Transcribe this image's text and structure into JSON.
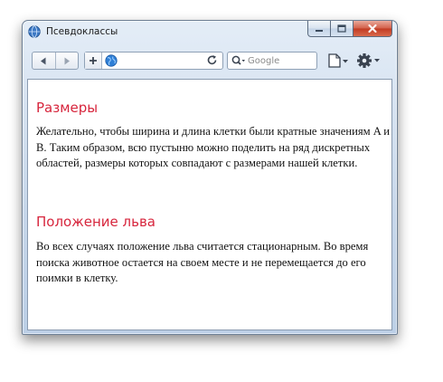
{
  "window": {
    "title": "Псевдоклассы"
  },
  "toolbar": {
    "search_placeholder": "Google"
  },
  "sections": [
    {
      "heading": "Размеры",
      "text": "Желательно, чтобы ширина и длина клетки были кратные значениям A и B. Таким образом, всю пустыню можно поделить на ряд дискретных областей, размеры которых совпадают с размерами нашей клетки."
    },
    {
      "heading": "Положение льва",
      "text": "Во всех случаях положение льва считается стационарным. Во время поиска животное остается на своем месте и не перемещается до его поимки в клетку."
    }
  ],
  "colors": {
    "heading": "#d7263d",
    "close_button": "#c13a22"
  }
}
